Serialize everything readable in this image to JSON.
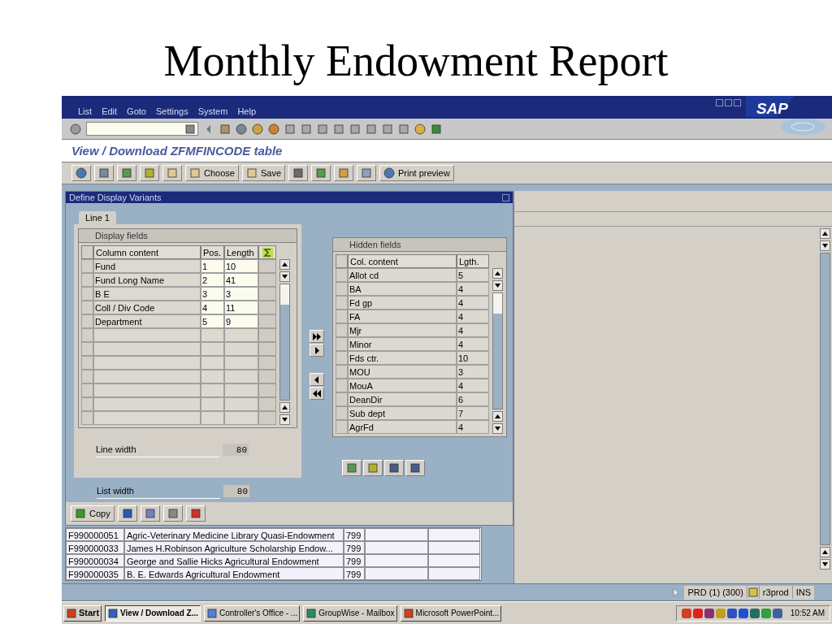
{
  "slide_title": "Monthly Endowment Report",
  "menu": [
    {
      "label": "List"
    },
    {
      "label": "Edit"
    },
    {
      "label": "Goto"
    },
    {
      "label": "Settings"
    },
    {
      "label": "System"
    },
    {
      "label": "Help"
    }
  ],
  "logo": "SAP",
  "screen_title": "View / Download ZFMFINCODE table",
  "app_toolbar": [
    {
      "label": "Choose"
    },
    {
      "label": "Save"
    },
    {
      "label": "Print preview"
    }
  ],
  "dialog": {
    "title": "Define Display Variants",
    "tabs": [
      {
        "label": "Line 1",
        "selected": true
      }
    ],
    "display_fields": {
      "title": "Display fields",
      "columns": [
        "Column content",
        "Pos.",
        "Length"
      ],
      "rows": [
        [
          "Fund",
          "1",
          "10"
        ],
        [
          "Fund Long Name",
          "2",
          "41"
        ],
        [
          "B E",
          "3",
          "3"
        ],
        [
          "Coll / Div Code",
          "4",
          "11"
        ],
        [
          "Department",
          "5",
          "9"
        ]
      ]
    },
    "hidden_fields": {
      "title": "Hidden fields",
      "columns": [
        "Col. content",
        "Lgth."
      ],
      "rows": [
        [
          "Allot cd",
          "5"
        ],
        [
          "BA",
          "4"
        ],
        [
          "Fd gp",
          "4"
        ],
        [
          "FA",
          "4"
        ],
        [
          "Mjr",
          "4"
        ],
        [
          "Minor",
          "4"
        ],
        [
          "Fds ctr.",
          "10"
        ],
        [
          "MOU",
          "3"
        ],
        [
          "MouA",
          "4"
        ],
        [
          "DeanDir",
          "6"
        ],
        [
          "Sub dept",
          "7"
        ],
        [
          "AgrFd",
          "4"
        ]
      ]
    },
    "line_width": {
      "label": "Line width",
      "value": "80"
    },
    "list_width": {
      "label": "List width",
      "value": "80"
    },
    "copy_button": "Copy"
  },
  "list_rows": [
    [
      "F990000051",
      "Agric-Veterinary Medicine Library Quasi-Endowment",
      "799"
    ],
    [
      "F990000033",
      "James H.Robinson Agriculture Scholarship Endow...",
      "799"
    ],
    [
      "F990000034",
      "George and Sallie Hicks Agricultural Endowment",
      "799"
    ],
    [
      "F990000035",
      "B. E. Edwards Agricultural Endowment",
      "799"
    ]
  ],
  "status_bar": {
    "system": "PRD (1) (300)",
    "server": "r3prod",
    "mode": "INS"
  },
  "taskbar": {
    "start": "Start",
    "tasks": [
      {
        "label": "View / Download Z...",
        "selected": true
      },
      {
        "label": "Controller's Office - ...",
        "selected": false
      },
      {
        "label": "GroupWise - Mailbox",
        "selected": false
      },
      {
        "label": "Microsoft PowerPoint...",
        "selected": false
      }
    ],
    "clock": "10:52 AM"
  }
}
